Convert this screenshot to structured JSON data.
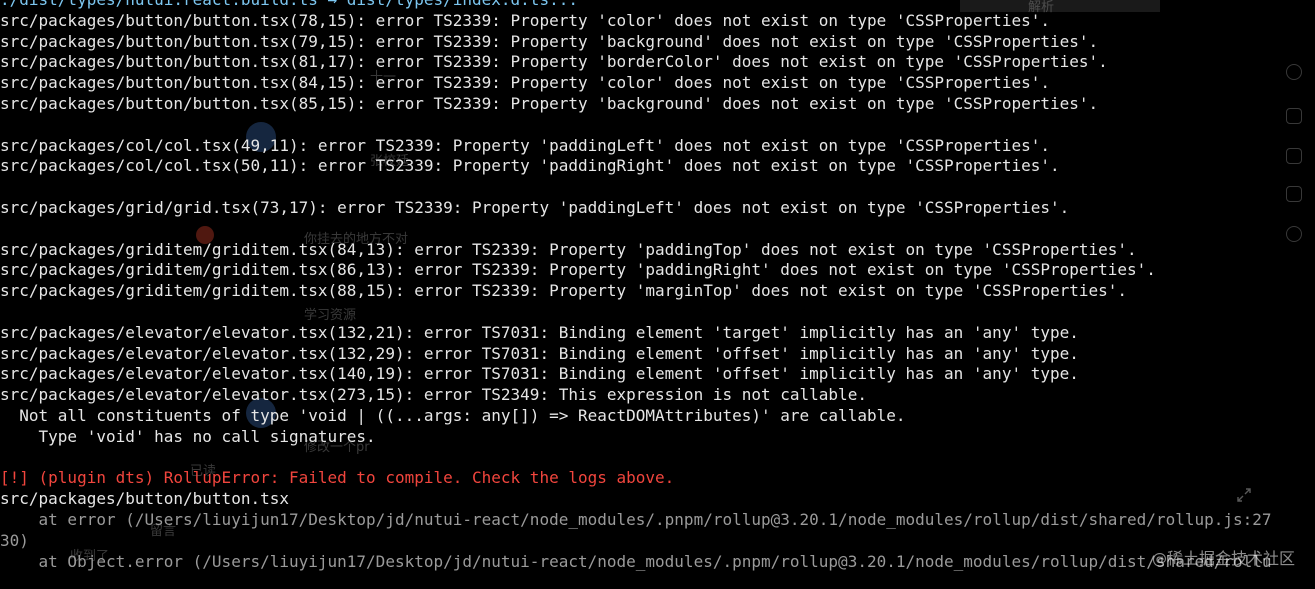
{
  "terminal": {
    "lines": [
      {
        "text": "./dist/types/nutui.react.build.ts → dist/types/index.d.ts...",
        "kind": "path"
      },
      {
        "text": "src/packages/button/button.tsx(78,15): error TS2339: Property 'color' does not exist on type 'CSSProperties'.",
        "kind": "normal"
      },
      {
        "text": "src/packages/button/button.tsx(79,15): error TS2339: Property 'background' does not exist on type 'CSSProperties'.",
        "kind": "normal"
      },
      {
        "text": "src/packages/button/button.tsx(81,17): error TS2339: Property 'borderColor' does not exist on type 'CSSProperties'.",
        "kind": "normal"
      },
      {
        "text": "src/packages/button/button.tsx(84,15): error TS2339: Property 'color' does not exist on type 'CSSProperties'.",
        "kind": "normal"
      },
      {
        "text": "src/packages/button/button.tsx(85,15): error TS2339: Property 'background' does not exist on type 'CSSProperties'.",
        "kind": "normal"
      },
      {
        "text": "",
        "kind": "blank"
      },
      {
        "text": "src/packages/col/col.tsx(49,11): error TS2339: Property 'paddingLeft' does not exist on type 'CSSProperties'.",
        "kind": "normal"
      },
      {
        "text": "src/packages/col/col.tsx(50,11): error TS2339: Property 'paddingRight' does not exist on type 'CSSProperties'.",
        "kind": "normal"
      },
      {
        "text": "",
        "kind": "blank"
      },
      {
        "text": "src/packages/grid/grid.tsx(73,17): error TS2339: Property 'paddingLeft' does not exist on type 'CSSProperties'.",
        "kind": "normal"
      },
      {
        "text": "",
        "kind": "blank"
      },
      {
        "text": "src/packages/griditem/griditem.tsx(84,13): error TS2339: Property 'paddingTop' does not exist on type 'CSSProperties'.",
        "kind": "normal"
      },
      {
        "text": "src/packages/griditem/griditem.tsx(86,13): error TS2339: Property 'paddingRight' does not exist on type 'CSSProperties'.",
        "kind": "normal"
      },
      {
        "text": "src/packages/griditem/griditem.tsx(88,15): error TS2339: Property 'marginTop' does not exist on type 'CSSProperties'.",
        "kind": "normal"
      },
      {
        "text": "",
        "kind": "blank"
      },
      {
        "text": "src/packages/elevator/elevator.tsx(132,21): error TS7031: Binding element 'target' implicitly has an 'any' type.",
        "kind": "normal"
      },
      {
        "text": "src/packages/elevator/elevator.tsx(132,29): error TS7031: Binding element 'offset' implicitly has an 'any' type.",
        "kind": "normal"
      },
      {
        "text": "src/packages/elevator/elevator.tsx(140,19): error TS7031: Binding element 'offset' implicitly has an 'any' type.",
        "kind": "normal"
      },
      {
        "text": "src/packages/elevator/elevator.tsx(273,15): error TS2349: This expression is not callable.",
        "kind": "normal"
      },
      {
        "text": "  Not all constituents of type 'void | ((...args: any[]) => ReactDOMAttributes)' are callable.",
        "kind": "normal"
      },
      {
        "text": "    Type 'void' has no call signatures.",
        "kind": "normal"
      },
      {
        "text": "",
        "kind": "blank"
      },
      {
        "text": "[!] (plugin dts) RollupError: Failed to compile. Check the logs above.",
        "kind": "err"
      },
      {
        "text": "src/packages/button/button.tsx",
        "kind": "normal"
      },
      {
        "text": "    at error (/Users/liuyijun17/Desktop/jd/nutui-react/node_modules/.pnpm/rollup@3.20.1/node_modules/rollup/dist/shared/rollup.js:27",
        "kind": "dim"
      },
      {
        "text": "30)",
        "kind": "dim"
      },
      {
        "text": "    at Object.error (/Users/liuyijun17/Desktop/jd/nutui-react/node_modules/.pnpm/rollup@3.20.1/node_modules/rollup/dist/shared/rollu",
        "kind": "dim"
      }
    ]
  },
  "background_app": {
    "header_text": "解析",
    "snippets": [
      "十一",
      "张校廷",
      "你挂去的地方不对",
      "学习资源",
      "修改一个pr",
      "收到了",
      "已读",
      "留言"
    ]
  },
  "watermark": {
    "at": "@",
    "text": "稀土掘金技术社区"
  },
  "colors": {
    "background": "#000000",
    "text": "#e6e6e6",
    "path": "#7cc6f0",
    "error": "#f1453d",
    "dim": "#9a9a9a"
  }
}
